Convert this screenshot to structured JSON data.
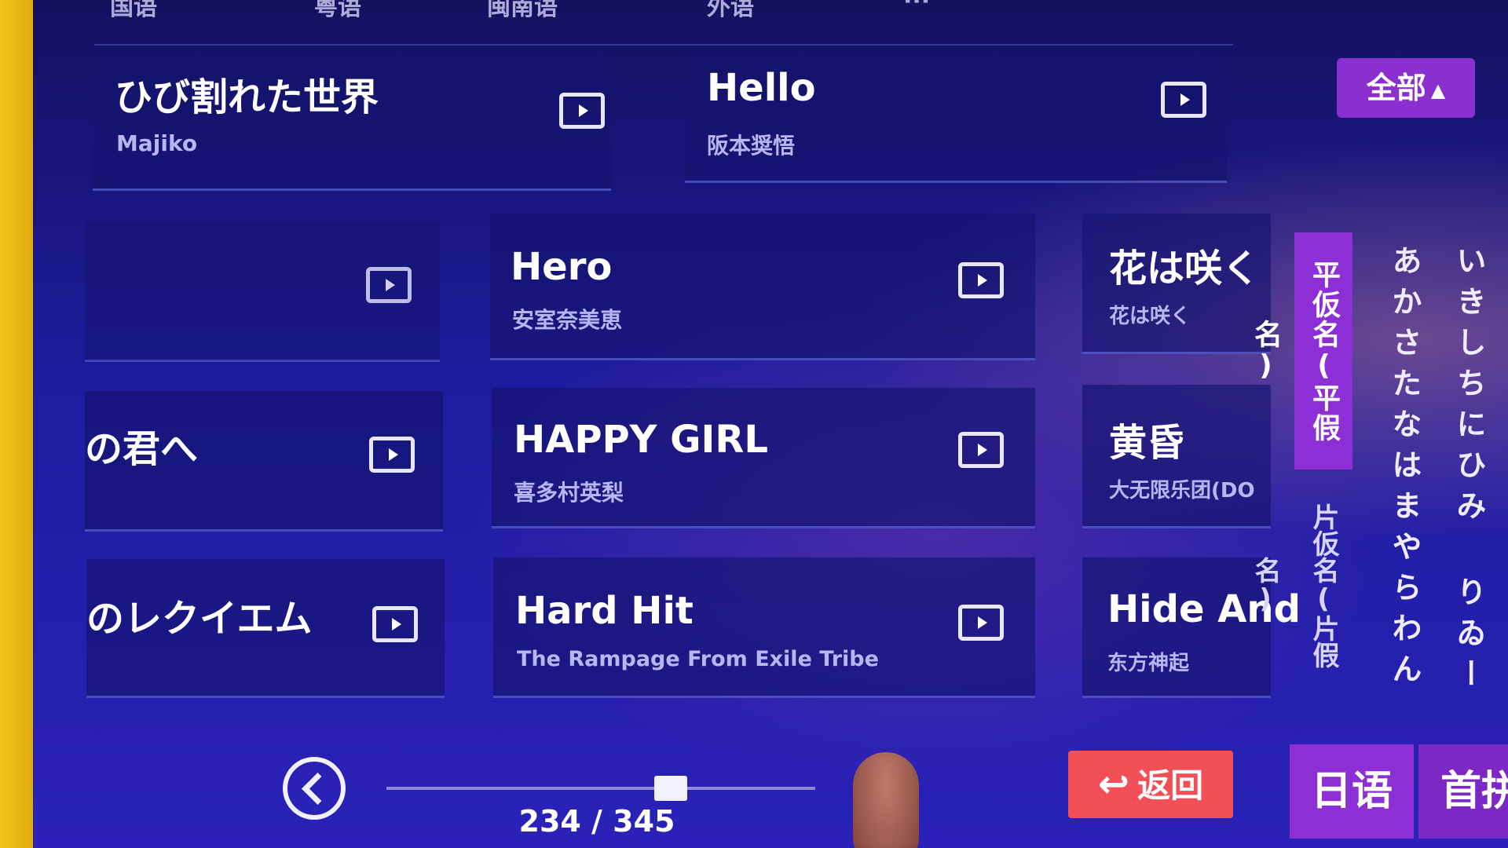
{
  "top_tabs": [
    "国语",
    "粤语",
    "闽南语",
    "外语",
    "···"
  ],
  "filter": {
    "label": "全部"
  },
  "songs": [
    {
      "title": "ひび割れた世界",
      "artist": "Majiko"
    },
    {
      "title": "Hello",
      "artist": "阪本奨悟"
    },
    {
      "title": "",
      "artist": ""
    },
    {
      "title": "Hero",
      "artist": "安室奈美恵"
    },
    {
      "title": "花は咲く",
      "artist": "花は咲く"
    },
    {
      "title": "の君へ",
      "artist": ""
    },
    {
      "title": "HAPPY GIRL",
      "artist": "喜多村英梨"
    },
    {
      "title": "黄昏",
      "artist": "大无限乐团(DO"
    },
    {
      "title": "のレクイエム",
      "artist": ""
    },
    {
      "title": "Hard Hit",
      "artist": "The Rampage From Exile Tribe"
    },
    {
      "title": "Hide And",
      "artist": "东方神起"
    }
  ],
  "kana_panel": {
    "active_tab": "平仮名(平假名)",
    "other_tab": "片仮名(片假名)",
    "column_1": "あかさたなはまやらわん",
    "column_2": "いきしちにひみ りゐー"
  },
  "pagination": {
    "current": 234,
    "total": 345,
    "label": "234 / 345"
  },
  "back_button": {
    "label": "返回"
  },
  "language_tabs": {
    "active": "日语",
    "other": "首拼"
  }
}
